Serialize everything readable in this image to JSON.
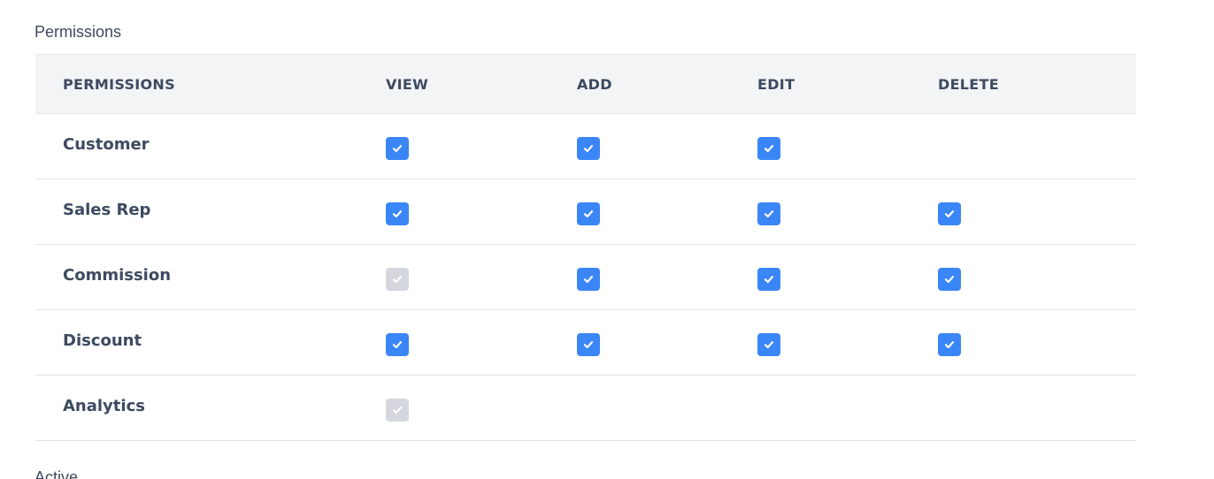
{
  "section": {
    "title": "Permissions",
    "next_title": "Active"
  },
  "table": {
    "columns": [
      "PERMISSIONS",
      "VIEW",
      "ADD",
      "EDIT",
      "DELETE"
    ],
    "rows": [
      {
        "name": "Customer",
        "view": "checked",
        "add": "checked",
        "edit": "checked",
        "delete": "none"
      },
      {
        "name": "Sales Rep",
        "view": "checked",
        "add": "checked",
        "edit": "checked",
        "delete": "checked"
      },
      {
        "name": "Commission",
        "view": "disabled",
        "add": "checked",
        "edit": "checked",
        "delete": "checked"
      },
      {
        "name": "Discount",
        "view": "checked",
        "add": "checked",
        "edit": "checked",
        "delete": "checked"
      },
      {
        "name": "Analytics",
        "view": "disabled",
        "add": "none",
        "edit": "none",
        "delete": "none"
      }
    ]
  },
  "colors": {
    "checked": "#3b86f7",
    "disabled": "#d4d7dd",
    "text": "#3d4a60"
  },
  "icons": {
    "check": "check-icon"
  }
}
